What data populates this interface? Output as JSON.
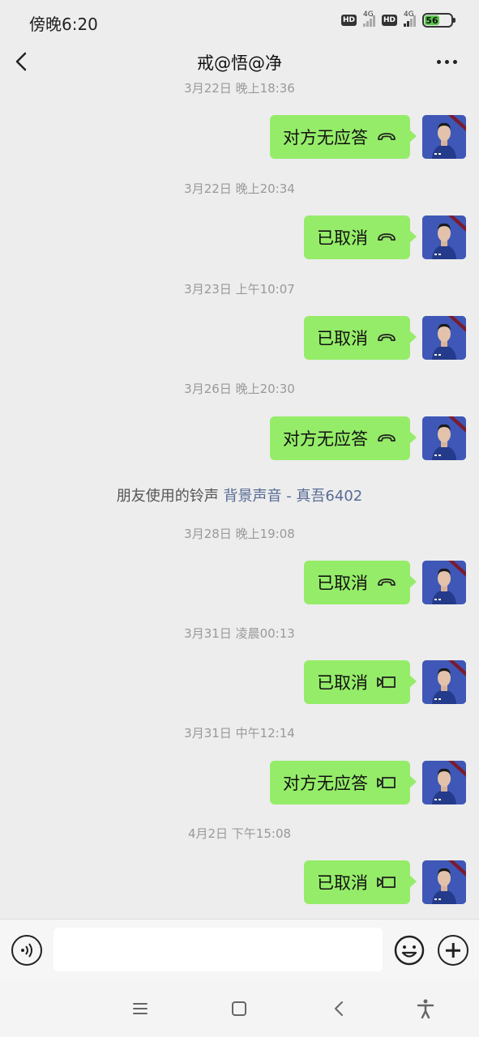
{
  "status_bar": {
    "time": "傍晚6:20",
    "hd1": "HD",
    "net1": "4G",
    "hd2": "HD",
    "net2": "4G",
    "battery": "56",
    "battery_color": "#59c84a"
  },
  "header": {
    "title": "戒@悟@净",
    "back_icon": "chevron-left-icon",
    "more_icon": "more-dots-icon"
  },
  "colors": {
    "bubble": "#95ec69",
    "background": "#ededed",
    "link": "#576b95",
    "avatar_bg": "#3f57b6"
  },
  "messages": [
    {
      "kind": "timestamp",
      "text": "3月22日 晚上18:36"
    },
    {
      "kind": "call",
      "text": "对方无应答",
      "icon": "voice-call-icon"
    },
    {
      "kind": "timestamp",
      "text": "3月22日 晚上20:34"
    },
    {
      "kind": "call",
      "text": "已取消",
      "icon": "voice-call-icon"
    },
    {
      "kind": "timestamp",
      "text": "3月23日 上午10:07"
    },
    {
      "kind": "call",
      "text": "已取消",
      "icon": "voice-call-icon"
    },
    {
      "kind": "timestamp",
      "text": "3月26日 晚上20:30"
    },
    {
      "kind": "call",
      "text": "对方无应答",
      "icon": "voice-call-icon"
    },
    {
      "kind": "system",
      "text": "朋友使用的铃声",
      "link": "背景声音 - 真吾6402"
    },
    {
      "kind": "timestamp",
      "text": "3月28日 晚上19:08"
    },
    {
      "kind": "call",
      "text": "已取消",
      "icon": "voice-call-icon"
    },
    {
      "kind": "timestamp",
      "text": "3月31日 凌晨00:13"
    },
    {
      "kind": "call",
      "text": "已取消",
      "icon": "video-call-icon"
    },
    {
      "kind": "timestamp",
      "text": "3月31日 中午12:14"
    },
    {
      "kind": "call",
      "text": "对方无应答",
      "icon": "video-call-icon"
    },
    {
      "kind": "timestamp",
      "text": "4月2日 下午15:08"
    },
    {
      "kind": "call",
      "text": "已取消",
      "icon": "video-call-icon"
    }
  ],
  "input_bar": {
    "voice_icon": "voice-input-icon",
    "input_value": "",
    "emoji_icon": "emoji-icon",
    "plus_icon": "plus-icon"
  },
  "nav_bar": {
    "icons": [
      "menu-icon",
      "home-icon",
      "back-icon",
      "accessibility-icon"
    ]
  }
}
